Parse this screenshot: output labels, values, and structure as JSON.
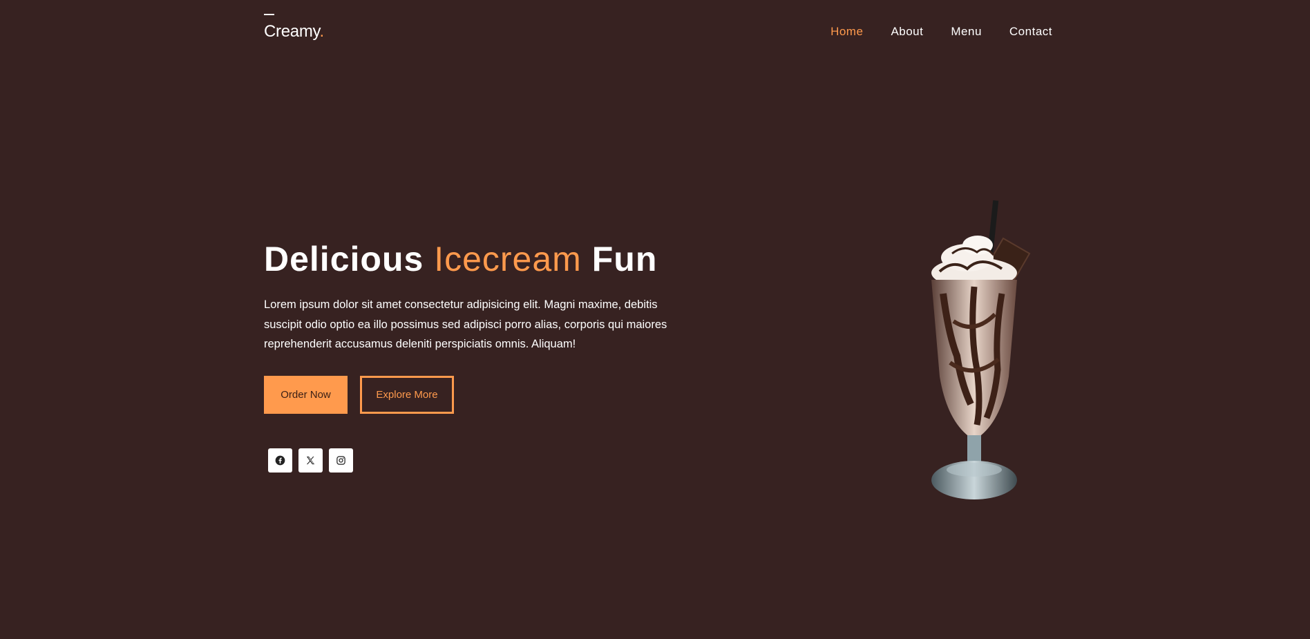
{
  "header": {
    "logo_text": "Creamy",
    "logo_dot": ".",
    "nav": [
      {
        "label": "Home",
        "active": true
      },
      {
        "label": "About",
        "active": false
      },
      {
        "label": "Menu",
        "active": false
      },
      {
        "label": "Contact",
        "active": false
      }
    ]
  },
  "hero": {
    "title_part1": "Delicious",
    "title_accent": "Icecream",
    "title_part2": "Fun",
    "description": "Lorem ipsum dolor sit amet consectetur adipisicing elit. Magni maxime, debitis suscipit odio optio ea illo possimus sed adipisci porro alias, corporis qui maiores reprehenderit accusamus deleniti perspiciatis omnis. Aliquam!",
    "order_button": "Order Now",
    "explore_button": "Explore More"
  },
  "socials": [
    {
      "icon": "facebook-icon"
    },
    {
      "icon": "x-twitter-icon"
    },
    {
      "icon": "instagram-icon"
    }
  ],
  "image": {
    "subject": "chocolate milkshake with whipped cream, straw and chocolate square"
  },
  "colors": {
    "background": "#372221",
    "accent": "#ff9a4d",
    "text": "#ffffff"
  }
}
